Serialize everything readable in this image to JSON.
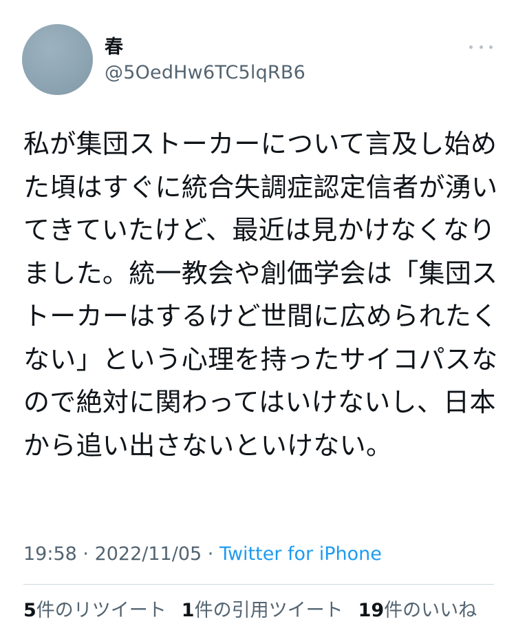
{
  "user": {
    "display_name": "春",
    "handle": "@5OedHw6TC5lqRB6"
  },
  "tweet": {
    "text": "私が集団ストーカーについて言及し始めた頃はすぐに統合失調症認定信者が湧いてきていたけど、最近は見かけなくなりました。統一教会や創価学会は「集団ストーカーはするけど世間に広められたくない」という心理を持ったサイコパスなので絶対に関わってはいけないし、日本から追い出さないといけない。"
  },
  "meta": {
    "time": "19:58",
    "separator1": " · ",
    "date": "2022/11/05",
    "separator2": " · ",
    "source": "Twitter for iPhone"
  },
  "stats": {
    "retweets": {
      "count": "5",
      "label": "件のリツイート"
    },
    "quotes": {
      "count": "1",
      "label": "件の引用ツイート"
    },
    "likes": {
      "count": "19",
      "label": "件のいいね"
    }
  },
  "icons": {
    "more": "more-horizontal-icon"
  }
}
